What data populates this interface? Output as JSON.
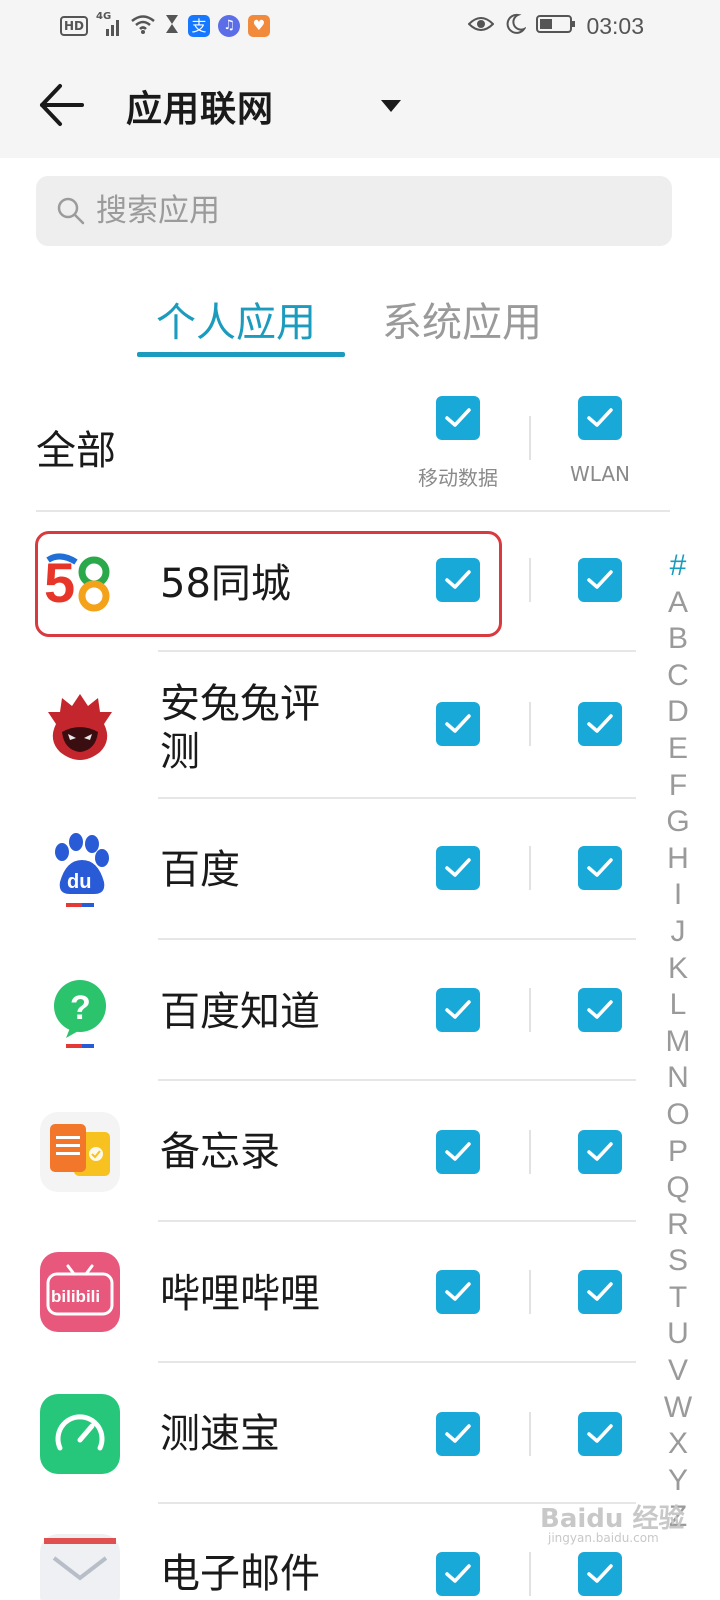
{
  "status_bar": {
    "hd": "HD",
    "network": "4G",
    "time": "03:03"
  },
  "header": {
    "title": "应用联网"
  },
  "search": {
    "placeholder": "搜索应用"
  },
  "tabs": [
    {
      "label": "个人应用",
      "active": true
    },
    {
      "label": "系统应用",
      "active": false
    }
  ],
  "all_row": {
    "label": "全部",
    "mobile_data_label": "移动数据",
    "wlan_label": "WLAN",
    "mobile_checked": true,
    "wlan_checked": true
  },
  "apps": [
    {
      "name": "58同城",
      "mobile": true,
      "wlan": true,
      "highlighted": true
    },
    {
      "name_line1": "安兔兔评",
      "name_line2": "测",
      "mobile": true,
      "wlan": true
    },
    {
      "name": "百度",
      "mobile": true,
      "wlan": true
    },
    {
      "name": "百度知道",
      "mobile": true,
      "wlan": true
    },
    {
      "name": "备忘录",
      "mobile": true,
      "wlan": true
    },
    {
      "name": "哔哩哔哩",
      "mobile": true,
      "wlan": true
    },
    {
      "name": "测速宝",
      "mobile": true,
      "wlan": true
    },
    {
      "name": "电子邮件",
      "mobile": true,
      "wlan": true
    }
  ],
  "icon_text": {
    "fifty_eight": "58",
    "baidu": "du",
    "bilibili": "bilibili",
    "zhidao": "?"
  },
  "index_bar": [
    "#",
    "A",
    "B",
    "C",
    "D",
    "E",
    "F",
    "G",
    "H",
    "I",
    "J",
    "K",
    "L",
    "M",
    "N",
    "O",
    "P",
    "Q",
    "R",
    "S",
    "T",
    "U",
    "V",
    "W",
    "X",
    "Y",
    "Z"
  ],
  "watermark": {
    "main": "Baidu 经验",
    "sub": "jingyan.baidu.com"
  },
  "colors": {
    "accent": "#1b9bbd",
    "checkbox": "#19a9d9",
    "highlight": "#d93a40"
  }
}
